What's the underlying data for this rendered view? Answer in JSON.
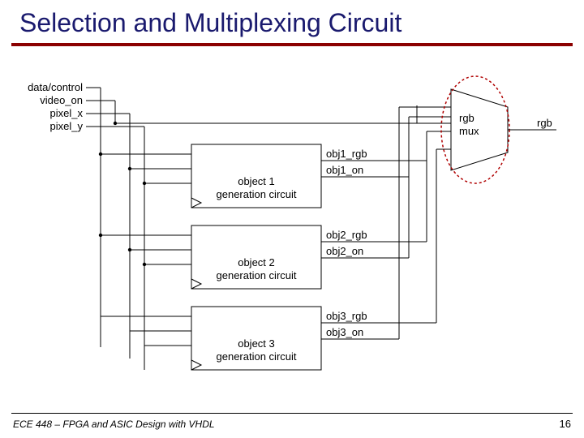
{
  "slide": {
    "title": "Selection and Multiplexing Circuit",
    "footer_left": "ECE 448 – FPGA and ASIC Design with VHDL",
    "page_number": "16"
  },
  "inputs": {
    "data_control": "data/control",
    "video_on": "video_on",
    "pixel_x": "pixel_x",
    "pixel_y": "pixel_y"
  },
  "blocks": {
    "obj1": {
      "line1": "object 1",
      "line2": "generation circuit"
    },
    "obj2": {
      "line1": "object 2",
      "line2": "generation circuit"
    },
    "obj3": {
      "line1": "object 3",
      "line2": "generation circuit"
    },
    "mux": {
      "line1": "rgb",
      "line2": "mux"
    }
  },
  "signals": {
    "obj1_rgb": "obj1_rgb",
    "obj1_on": "obj1_on",
    "obj2_rgb": "obj2_rgb",
    "obj2_on": "obj2_on",
    "obj3_rgb": "obj3_rgb",
    "obj3_on": "obj3_on",
    "out": "rgb"
  }
}
